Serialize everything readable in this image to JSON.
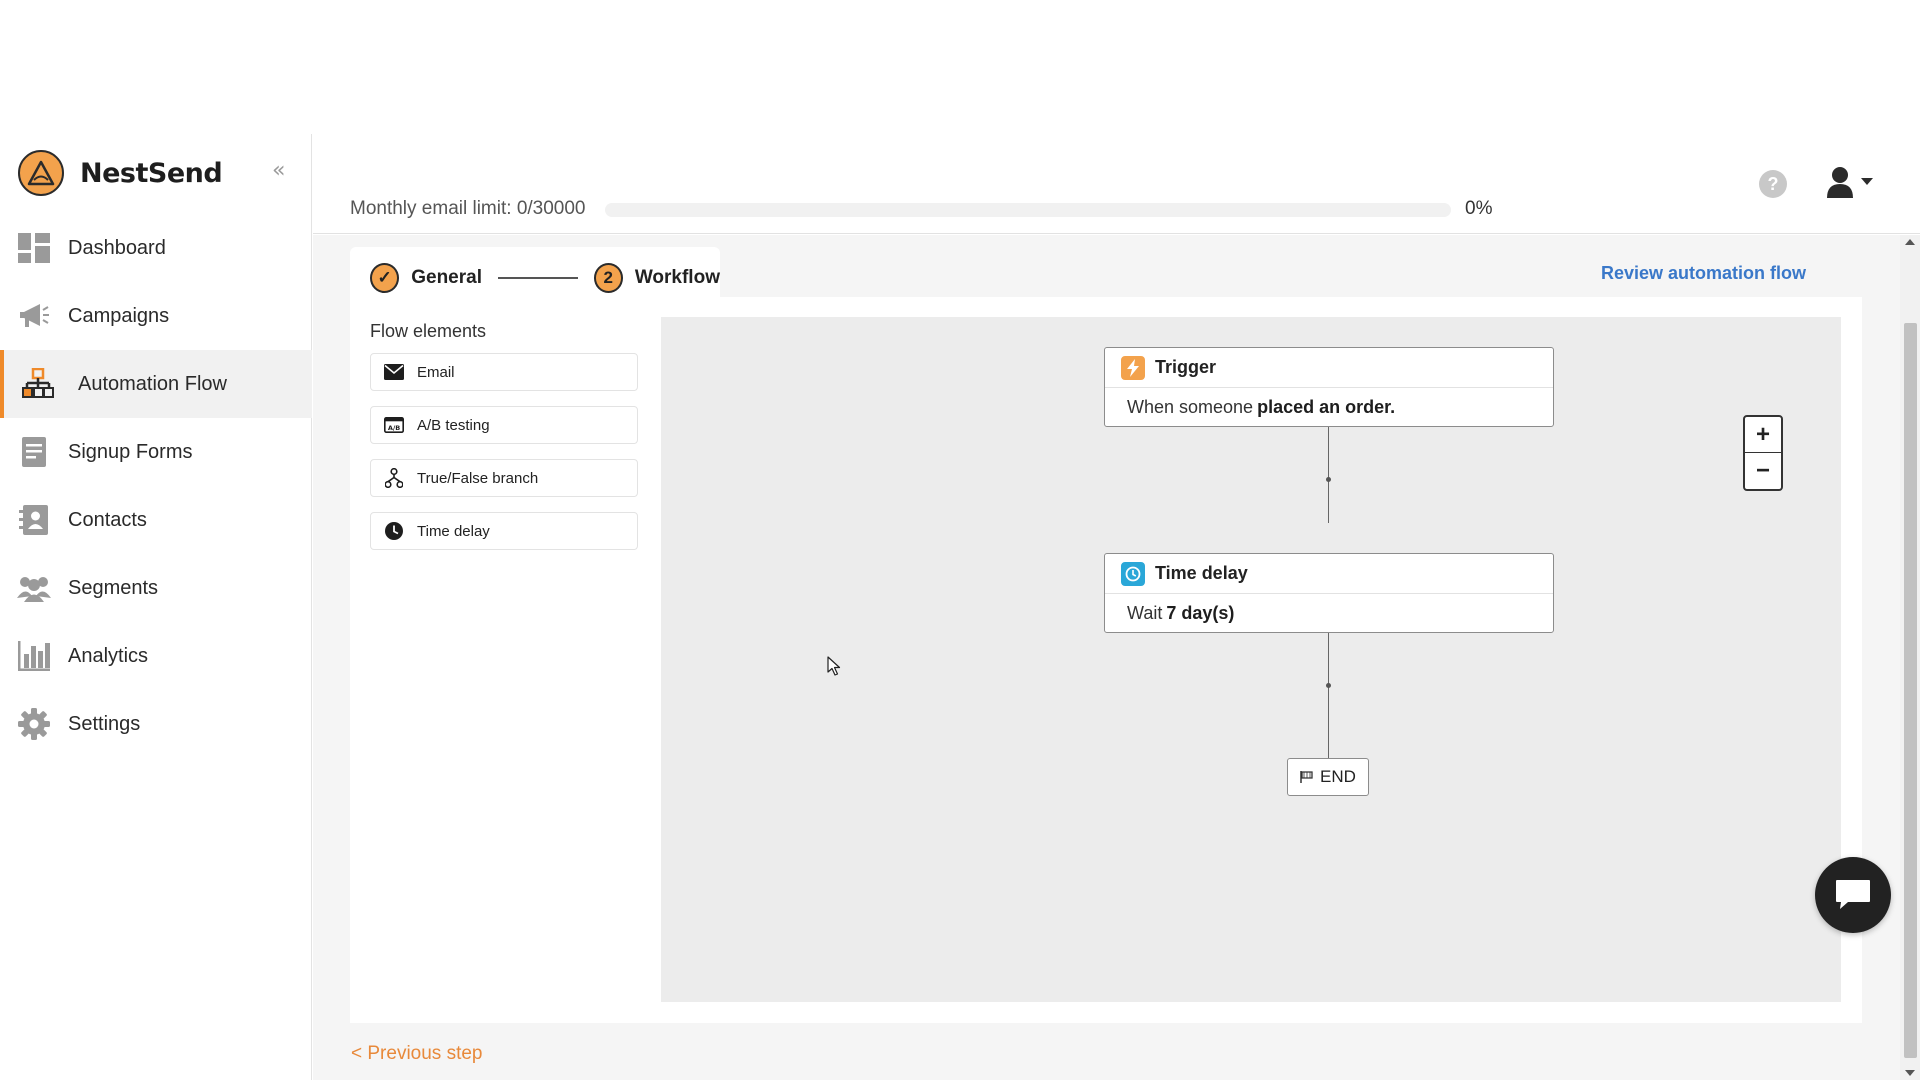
{
  "brand": {
    "name": "NestSend",
    "collapse_icon": "«"
  },
  "sidebar": {
    "items": [
      {
        "label": "Dashboard",
        "icon": "dashboard-icon"
      },
      {
        "label": "Campaigns",
        "icon": "megaphone-icon"
      },
      {
        "label": "Automation Flow",
        "icon": "sitemap-icon",
        "active": true
      },
      {
        "label": "Signup Forms",
        "icon": "form-icon"
      },
      {
        "label": "Contacts",
        "icon": "contact-card-icon"
      },
      {
        "label": "Segments",
        "icon": "users-icon"
      },
      {
        "label": "Analytics",
        "icon": "bar-chart-icon"
      },
      {
        "label": "Settings",
        "icon": "gear-icon"
      }
    ]
  },
  "header": {
    "limit_label": "Monthly email limit: 0/30000",
    "limit_progress": 0,
    "limit_percent": "0%",
    "help": "?"
  },
  "stepper": {
    "steps": [
      {
        "label": "General",
        "status": "done",
        "marker": "✓"
      },
      {
        "label": "Workflow",
        "status": "current",
        "marker": "2"
      }
    ]
  },
  "review_link": "Review automation flow",
  "flow_elements": {
    "title": "Flow elements",
    "items": [
      {
        "label": "Email",
        "icon": "envelope-icon"
      },
      {
        "label": "A/B testing",
        "icon": "ab-test-icon"
      },
      {
        "label": "True/False branch",
        "icon": "branch-icon"
      },
      {
        "label": "Time delay",
        "icon": "clock-icon"
      }
    ]
  },
  "workflow": {
    "trigger": {
      "title": "Trigger",
      "body_prefix": "When someone",
      "body_bold": "placed an order."
    },
    "delay": {
      "title": "Time delay",
      "body_prefix": "Wait",
      "body_bold": "7 day(s)"
    },
    "end_label": "END",
    "zoom_in": "+",
    "zoom_out": "−"
  },
  "prev_step": "< Previous step",
  "colors": {
    "accent": "#ef8a2a",
    "link": "#3a78c9",
    "trigger_icon_bg": "#f3a24c",
    "delay_icon_bg": "#2aa7d8"
  }
}
